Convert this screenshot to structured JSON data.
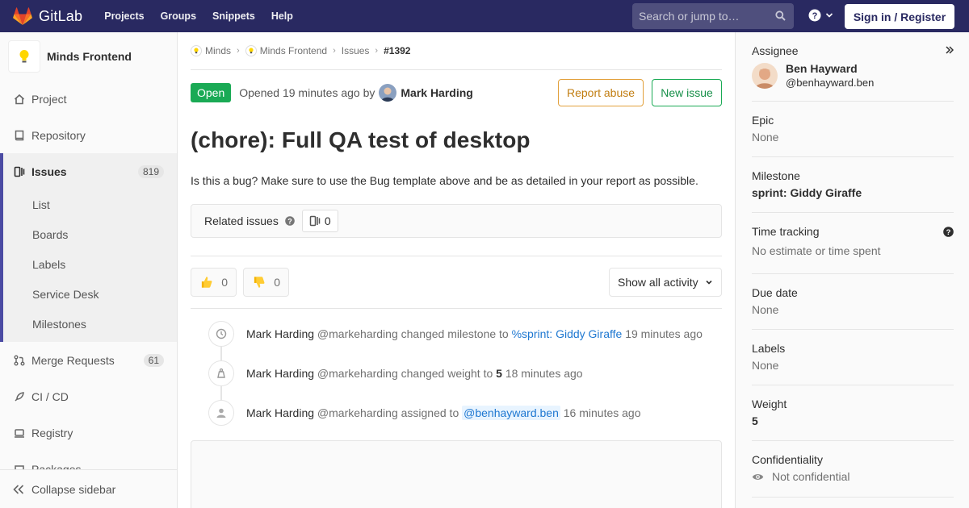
{
  "navbar": {
    "brand": "GitLab",
    "links": [
      "Projects",
      "Groups",
      "Snippets",
      "Help"
    ],
    "search_placeholder": "Search or jump to…",
    "signin_label": "Sign in / Register"
  },
  "sidebar": {
    "project_name": "Minds Frontend",
    "items": {
      "project": "Project",
      "repository": "Repository",
      "issues": "Issues",
      "issues_count": "819",
      "merge_requests": "Merge Requests",
      "mr_count": "61",
      "cicd": "CI / CD",
      "registry": "Registry",
      "packages": "Packages"
    },
    "sub_items": [
      "List",
      "Boards",
      "Labels",
      "Service Desk",
      "Milestones"
    ],
    "collapse_label": "Collapse sidebar"
  },
  "breadcrumb": {
    "group": "Minds",
    "project": "Minds Frontend",
    "section": "Issues",
    "issue": "#1392"
  },
  "issue": {
    "status": "Open",
    "opened_text": "Opened 19 minutes ago by",
    "author": "Mark Harding",
    "report_abuse": "Report abuse",
    "new_issue": "New issue",
    "title": "(chore): Full QA test of desktop",
    "description": "Is this a bug? Make sure to use the Bug template above and be as detailed in your report as possible.",
    "related_label": "Related issues",
    "related_count": "0",
    "thumbs_up_count": "0",
    "thumbs_down_count": "0",
    "activity_filter": "Show all activity"
  },
  "notes": [
    {
      "author": "Mark Harding",
      "handle": "@markeharding",
      "action": "changed milestone to",
      "ref": "%sprint: Giddy Giraffe",
      "time": "19 minutes ago"
    },
    {
      "author": "Mark Harding",
      "handle": "@markeharding",
      "action": "changed weight to",
      "ref": "5",
      "time": "18 minutes ago"
    },
    {
      "author": "Mark Harding",
      "handle": "@markeharding",
      "action": "assigned to",
      "ref": "@benhayward.ben",
      "time": "16 minutes ago"
    }
  ],
  "right_sidebar": {
    "assignee_title": "Assignee",
    "assignee_name": "Ben Hayward",
    "assignee_user": "@benhayward.ben",
    "epic_title": "Epic",
    "epic_value": "None",
    "milestone_title": "Milestone",
    "milestone_value": "sprint: Giddy Giraffe",
    "time_title": "Time tracking",
    "time_value": "No estimate or time spent",
    "due_title": "Due date",
    "due_value": "None",
    "labels_title": "Labels",
    "labels_value": "None",
    "weight_title": "Weight",
    "weight_value": "5",
    "conf_title": "Confidentiality",
    "conf_value": "Not confidential"
  },
  "colors": {
    "navbar": "#292961",
    "open_badge": "#1aaa55",
    "accent": "#4b4ba3",
    "link": "#1f78d1"
  }
}
